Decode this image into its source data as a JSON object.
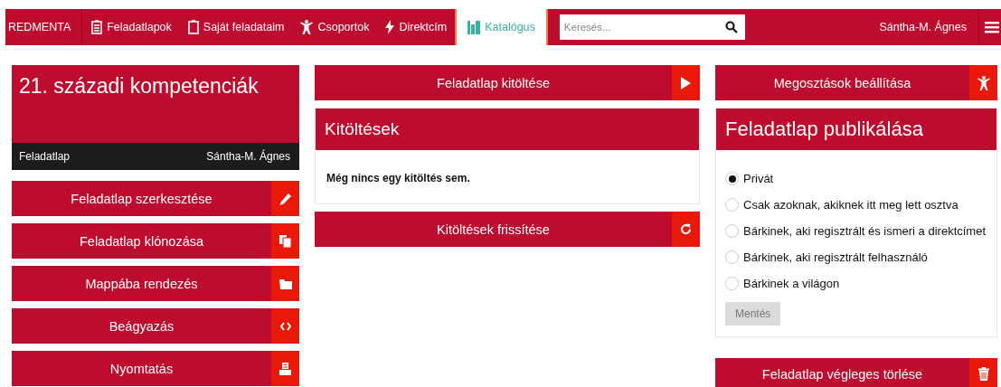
{
  "navbar": {
    "brand": "REDMENTA",
    "items": [
      {
        "label": "Feladatlapok",
        "selected": false
      },
      {
        "label": "Saját feladataim",
        "selected": false
      },
      {
        "label": "Csoportok",
        "selected": false
      },
      {
        "label": "Direktcím",
        "selected": false
      },
      {
        "label": "Katalógus",
        "selected": true
      }
    ],
    "search": {
      "placeholder": "Keresés..."
    },
    "user": "Sántha-M. Ágnes"
  },
  "worksheet": {
    "title": "21. századi kompetenciák",
    "type": "Feladatlap",
    "author": "Sántha-M. Ágnes"
  },
  "left_actions": [
    "Feladatlap szerkesztése",
    "Feladatlap klónozása",
    "Mappába rendezés",
    "Beágyazás",
    "Nyomtatás"
  ],
  "fill_button": "Feladatlap kitöltése",
  "submissions": {
    "title": "Kitöltések",
    "empty_message": "Még nincs egy kitöltés sem."
  },
  "refresh_button": "Kitöltések frissítése",
  "share_button": "Megosztások beállítása",
  "publish": {
    "title": "Feladatlap publikálása",
    "options": [
      {
        "label": "Privát",
        "selected": true
      },
      {
        "label": "Csak azoknak, akiknek itt meg lett osztva",
        "selected": false
      },
      {
        "label": "Bárkinek, aki regisztrált és ismeri a direktcímet",
        "selected": false
      },
      {
        "label": "Bárkinek, aki regisztrált felhasználó",
        "selected": false
      },
      {
        "label": "Bárkinek a világon",
        "selected": false
      }
    ],
    "save_button": "Mentés"
  },
  "delete_button": "Feladatlap végleges törlése"
}
